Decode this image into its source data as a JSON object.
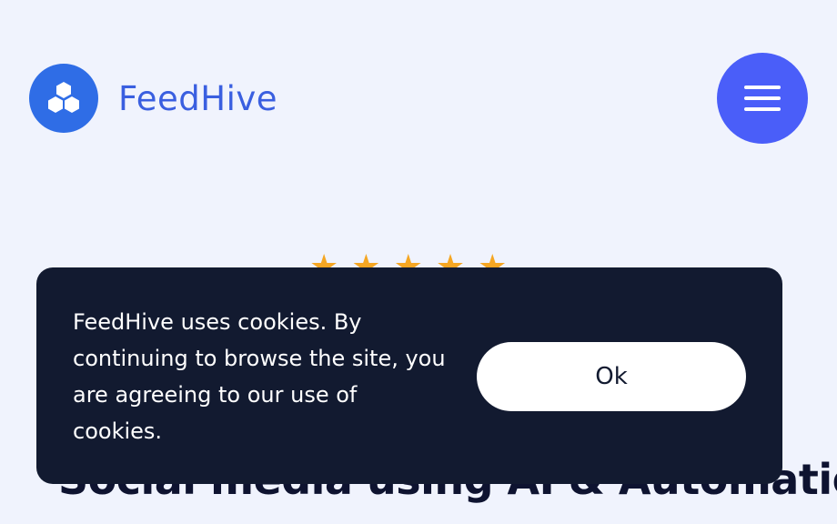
{
  "header": {
    "brand_name": "FeedHive",
    "logo_icon": "hexagon-cluster-icon",
    "menu_icon": "hamburger-menu-icon"
  },
  "hero": {
    "rating_stars": 5,
    "headline_visible_fragment": "Social media using AI & Automation."
  },
  "cookie_banner": {
    "message": "FeedHive uses cookies. By continuing to browse the site, you are agreeing to our use of cookies.",
    "ok_label": "Ok"
  },
  "colors": {
    "background": "#f0f3fd",
    "brand_blue": "#2f6de6",
    "brand_text": "#3a5fe0",
    "menu_button": "#4a5ef9",
    "banner_bg": "#121a30",
    "star": "#f5a623"
  }
}
